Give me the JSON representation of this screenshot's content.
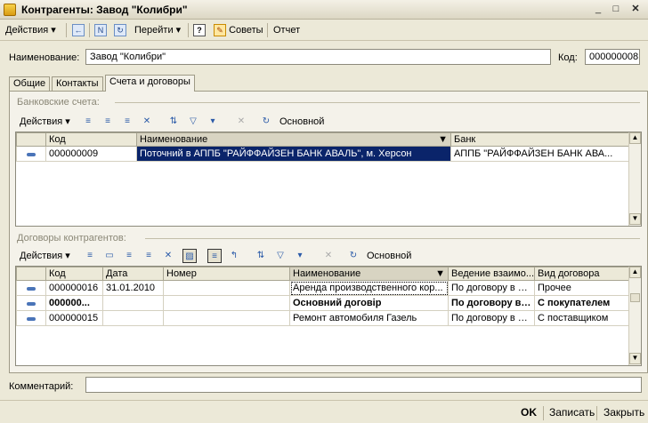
{
  "window": {
    "title": "Контрагенты: Завод \"Колибри\""
  },
  "toolbar": {
    "actions": "Действия",
    "goto": "Перейти",
    "help": "?",
    "tips": "Советы",
    "report": "Отчет"
  },
  "form": {
    "name_label": "Наименование:",
    "name_value": "Завод \"Колибри\"",
    "code_label": "Код:",
    "code_value": "000000008",
    "comment_label": "Комментарий:",
    "comment_value": ""
  },
  "tabs": [
    "Общие",
    "Контакты",
    "Счета и договоры"
  ],
  "bank": {
    "section_title": "Банковские счета:",
    "actions": "Действия",
    "main_label": "Основной",
    "columns": [
      "Код",
      "Наименование",
      "Банк"
    ],
    "rows": [
      {
        "code": "000000009",
        "name": "Поточний в АППБ \"РАЙФФАЙЗЕН БАНК АВАЛЬ\", м. Херсон",
        "bank": "АППБ \"РАЙФФАЙЗЕН БАНК АВА..."
      }
    ]
  },
  "contracts": {
    "section_title": "Договоры контрагентов:",
    "actions": "Действия",
    "main_label": "Основной",
    "columns": [
      "Код",
      "Дата",
      "Номер",
      "Наименование",
      "Ведение взаимо...",
      "Вид договора"
    ],
    "rows": [
      {
        "code": "000000016",
        "date": "31.01.2010",
        "number": "",
        "name": "Аренда производственного кор...",
        "mode": "По договору в ц...",
        "kind": "Прочее"
      },
      {
        "code": "000000...",
        "date": "",
        "number": "",
        "name": "Основний договір",
        "mode": "По договору в ...",
        "kind": "С покупателем"
      },
      {
        "code": "000000015",
        "date": "",
        "number": "",
        "name": "Ремонт автомобиля Газель",
        "mode": "По договору в ц...",
        "kind": "С поставщиком"
      }
    ]
  },
  "bottom": {
    "ok": "OK",
    "save": "Записать",
    "close": "Закрыть"
  }
}
